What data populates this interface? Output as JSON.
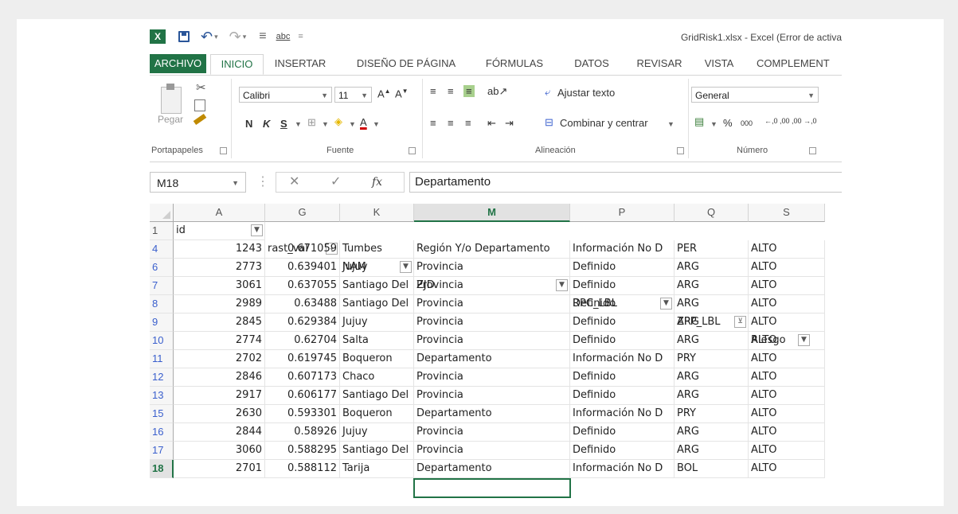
{
  "app": {
    "logo_letter": "X",
    "title": "GridRisk1.xlsx - Excel (Error de activa"
  },
  "tabs": [
    {
      "label": "ARCHIVO"
    },
    {
      "label": "INICIO"
    },
    {
      "label": "INSERTAR"
    },
    {
      "label": "DISEÑO DE PÁGINA"
    },
    {
      "label": "FÓRMULAS"
    },
    {
      "label": "DATOS"
    },
    {
      "label": "REVISAR"
    },
    {
      "label": "VISTA"
    },
    {
      "label": "COMPLEMENT"
    }
  ],
  "ribbon": {
    "paste_label": "Pegar",
    "font_name": "Calibri",
    "font_size": "11",
    "bold": "N",
    "italic": "K",
    "underline": "S",
    "wrap_text": "Ajustar texto",
    "merge_center": "Combinar y centrar",
    "number_format": "General",
    "percent": "%",
    "thousands": "000",
    "inc_decimal": "←,0 ,00",
    "dec_decimal": ",00 →,0",
    "groups": {
      "clipboard": "Portapapeles",
      "font": "Fuente",
      "alignment": "Alineación",
      "number": "Número"
    }
  },
  "formula_bar": {
    "name_box": "M18",
    "cancel": "✕",
    "enter": "✓",
    "fx": "fx",
    "value": "Departamento"
  },
  "sheet": {
    "columns": [
      "A",
      "G",
      "K",
      "M",
      "P",
      "Q",
      "S"
    ],
    "header_row_num": "1",
    "field_headers": [
      "id",
      "rast_val",
      "NAM",
      "ZJD",
      "RPC_LBL",
      "ZPP_LBL",
      "Riesgo"
    ],
    "rows": [
      {
        "rn": "4",
        "id": "1243",
        "rast_val": "0.671059",
        "nam": "Tumbes",
        "zjd": "Región Y/o Departamento",
        "rpc": "Información No D",
        "zpp": "PER",
        "riesgo": "ALTO"
      },
      {
        "rn": "6",
        "id": "2773",
        "rast_val": "0.639401",
        "nam": "Jujuy",
        "zjd": "Provincia",
        "rpc": "Definido",
        "zpp": "ARG",
        "riesgo": "ALTO"
      },
      {
        "rn": "7",
        "id": "3061",
        "rast_val": "0.637055",
        "nam": "Santiago Del",
        "zjd": "Provincia",
        "rpc": "Definido",
        "zpp": "ARG",
        "riesgo": "ALTO"
      },
      {
        "rn": "8",
        "id": "2989",
        "rast_val": "0.63488",
        "nam": "Santiago Del",
        "zjd": "Provincia",
        "rpc": "Definido",
        "zpp": "ARG",
        "riesgo": "ALTO"
      },
      {
        "rn": "9",
        "id": "2845",
        "rast_val": "0.629384",
        "nam": "Jujuy",
        "zjd": "Provincia",
        "rpc": "Definido",
        "zpp": "ARG",
        "riesgo": "ALTO"
      },
      {
        "rn": "10",
        "id": "2774",
        "rast_val": "0.62704",
        "nam": "Salta",
        "zjd": "Provincia",
        "rpc": "Definido",
        "zpp": "ARG",
        "riesgo": "ALTO"
      },
      {
        "rn": "11",
        "id": "2702",
        "rast_val": "0.619745",
        "nam": "Boqueron",
        "zjd": "Departamento",
        "rpc": "Información No D",
        "zpp": "PRY",
        "riesgo": "ALTO"
      },
      {
        "rn": "12",
        "id": "2846",
        "rast_val": "0.607173",
        "nam": "Chaco",
        "zjd": "Provincia",
        "rpc": "Definido",
        "zpp": "ARG",
        "riesgo": "ALTO"
      },
      {
        "rn": "13",
        "id": "2917",
        "rast_val": "0.606177",
        "nam": "Santiago Del",
        "zjd": "Provincia",
        "rpc": "Definido",
        "zpp": "ARG",
        "riesgo": "ALTO"
      },
      {
        "rn": "15",
        "id": "2630",
        "rast_val": "0.593301",
        "nam": "Boqueron",
        "zjd": "Departamento",
        "rpc": "Información No D",
        "zpp": "PRY",
        "riesgo": "ALTO"
      },
      {
        "rn": "16",
        "id": "2844",
        "rast_val": "0.58926",
        "nam": "Jujuy",
        "zjd": "Provincia",
        "rpc": "Definido",
        "zpp": "ARG",
        "riesgo": "ALTO"
      },
      {
        "rn": "17",
        "id": "3060",
        "rast_val": "0.588295",
        "nam": "Santiago Del",
        "zjd": "Provincia",
        "rpc": "Definido",
        "zpp": "ARG",
        "riesgo": "ALTO"
      },
      {
        "rn": "18",
        "id": "2701",
        "rast_val": "0.588112",
        "nam": "Tarija",
        "zjd": "Departamento",
        "rpc": "Información No D",
        "zpp": "BOL",
        "riesgo": "ALTO"
      }
    ]
  },
  "colors": {
    "excel_green": "#217346",
    "row_number_blue": "#3a5fcd"
  }
}
